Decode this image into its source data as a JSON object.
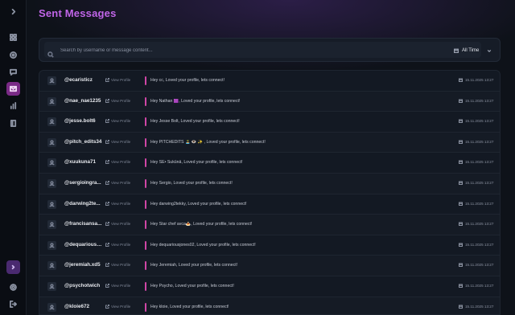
{
  "header": {
    "title": "Sent Messages"
  },
  "search": {
    "placeholder": "Search by username or message content...",
    "value": ""
  },
  "filter": {
    "selected": "All Time"
  },
  "sidebar": {
    "items": [
      {
        "name": "expand",
        "icon": "chevron-right-icon"
      },
      {
        "name": "dashboard",
        "icon": "grid-icon"
      },
      {
        "name": "discover",
        "icon": "compass-icon"
      },
      {
        "name": "messages",
        "icon": "chat-icon"
      },
      {
        "name": "sent",
        "icon": "mail-icon",
        "active": true
      },
      {
        "name": "analytics",
        "icon": "bar-chart-icon"
      },
      {
        "name": "library",
        "icon": "book-icon"
      },
      {
        "name": "profile",
        "icon": "user-icon"
      },
      {
        "name": "settings",
        "icon": "gear-icon"
      },
      {
        "name": "logout",
        "icon": "logout-icon"
      }
    ],
    "accent": "#7a2a86"
  },
  "view_profile_label": "View Profile",
  "accent_color": "#d046a6",
  "messages": [
    {
      "username": "@ecaristicz",
      "message": "Hey cc, Loved your profile, lets connect!",
      "date": "15.11.2025 13:27"
    },
    {
      "username": "@nae_nae1235",
      "message": "Hey Nathan 🟪, Loved your profile, lets connect!",
      "date": "15.11.2025 13:27"
    },
    {
      "username": "@jesse.bolt6",
      "message": "Hey Jesse Bolt, Loved your profile, lets connect!",
      "date": "15.11.2025 13:27"
    },
    {
      "username": "@pitch_edits34",
      "message": "Hey PITCHEDITS 🏝️ 👁️ ✨ , Loved your profile, lets connect!",
      "date": "15.11.2025 13:27"
    },
    {
      "username": "@xuukuna71",
      "message": "Hey SE• Sukūnā, Loved your profile, lets connect!",
      "date": "15.11.2025 13:27"
    },
    {
      "username": "@sergioingra...",
      "message": "Hey Sergio, Loved your profile, lets connect!",
      "date": "15.11.2025 13:27"
    },
    {
      "username": "@darwing2te...",
      "message": "Hey darwing2tekky, Loved your profile, lets connect!",
      "date": "15.11.2025 13:27"
    },
    {
      "username": "@francisansa...",
      "message": "Hey Star chef avca🍝, Loved your profile, lets connect!",
      "date": "15.11.2025 13:27"
    },
    {
      "username": "@dequariousj...",
      "message": "Hey dequariousjones02, Loved your profile, lets connect!",
      "date": "15.11.2025 13:27"
    },
    {
      "username": "@jeremiah.xd5",
      "message": "Hey Jeremiah, Loved your profile, lets connect!",
      "date": "15.11.2025 13:27"
    },
    {
      "username": "@psychotwich",
      "message": "Hey Psycho, Loved your profile, lets connect!",
      "date": "15.11.2025 13:27"
    },
    {
      "username": "@kloie672",
      "message": "Hey kloie, Loved your profile, lets connect!",
      "date": "15.11.2025 13:27"
    }
  ]
}
